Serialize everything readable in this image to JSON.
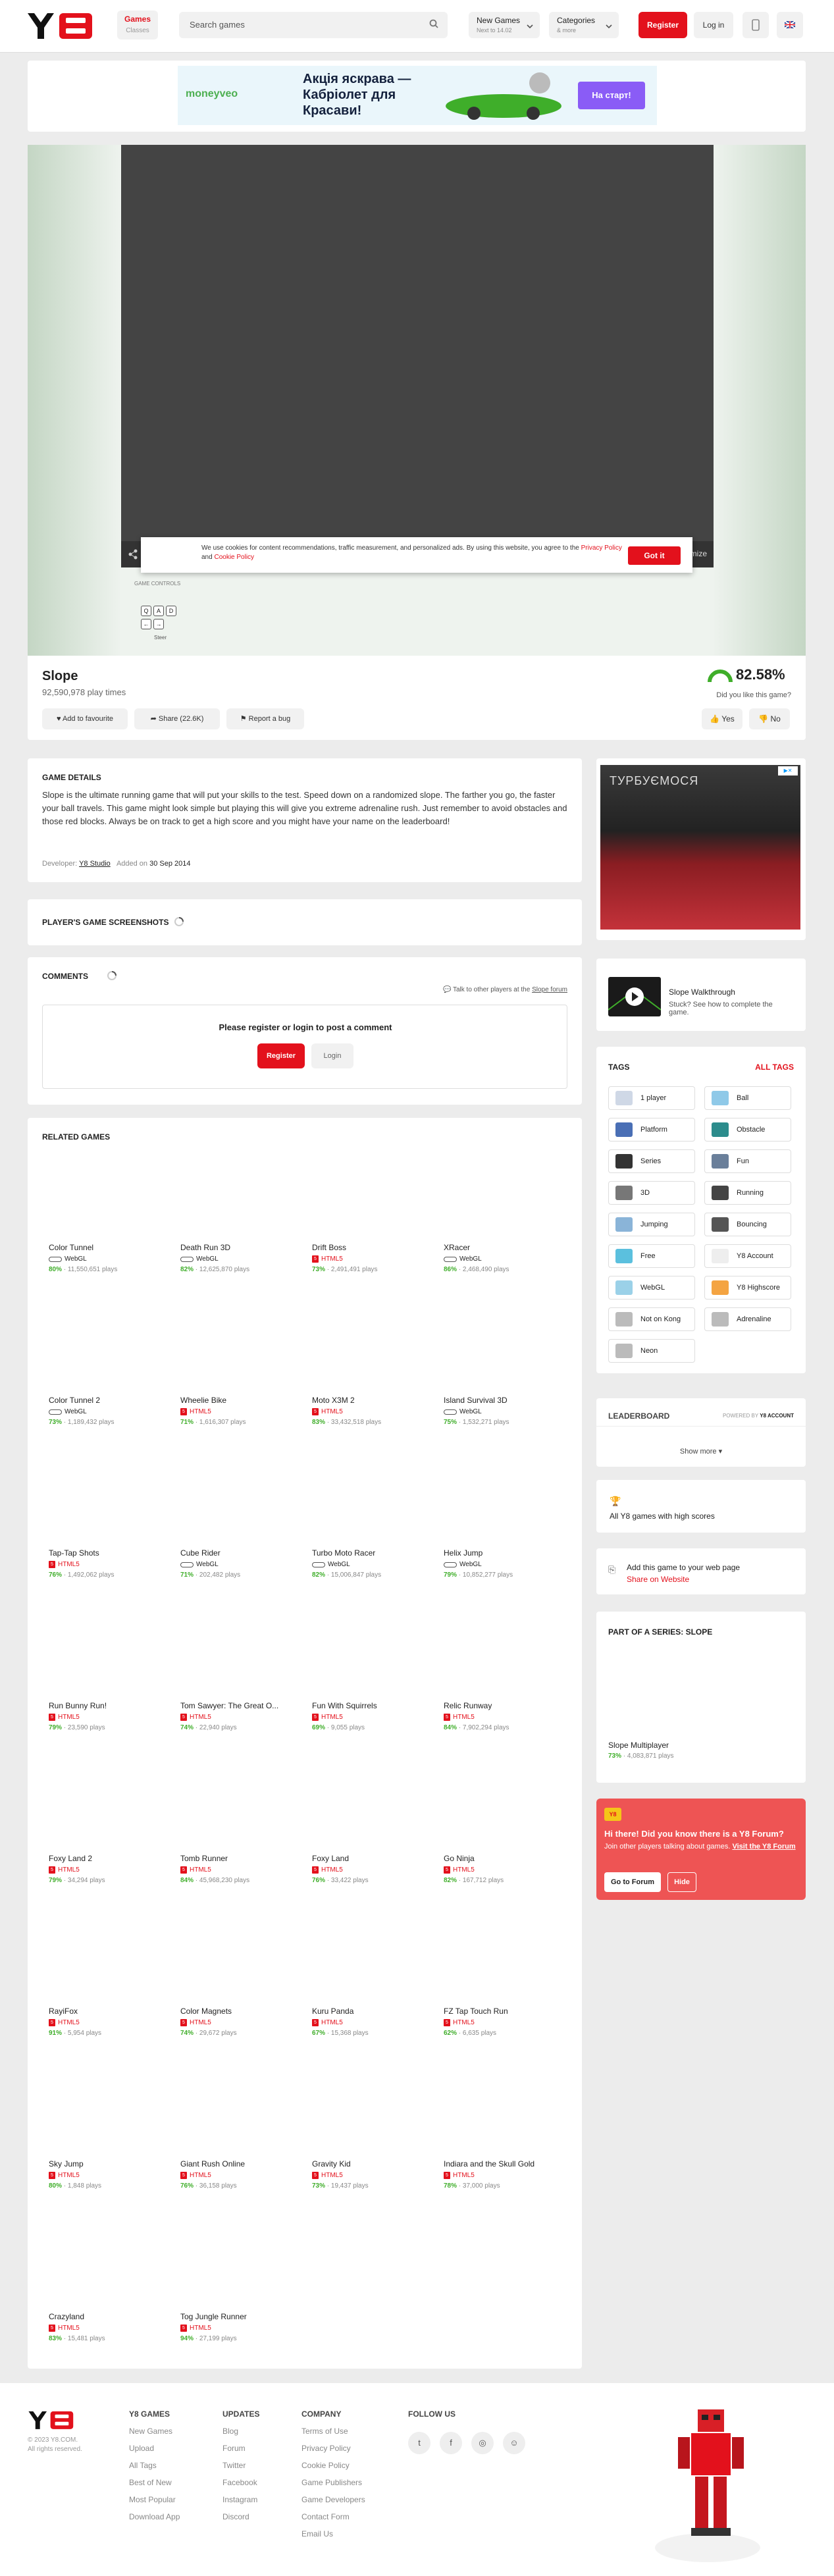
{
  "header": {
    "games_label": "Games",
    "games_sub": "Classes",
    "search_placeholder": "Search games",
    "new_games": "New Games",
    "new_games_sub": "Next to 14.02",
    "categories": "Categories",
    "categories_sub": "& more",
    "register": "Register",
    "login": "Log in"
  },
  "ad": {
    "brand": "moneyveo",
    "headline": "Акція яскрава — Кабріолет для Красави!",
    "cta": "На старт!"
  },
  "player": {
    "cookie_text": "We use cookies for content recommendations, traffic measurement, and personalized ads. By using this website, you agree to the",
    "privacy": "Privacy Policy",
    "and": "and",
    "cookie_policy": "Cookie Policy",
    "got_it": "Got it",
    "controls_label": "GAME CONTROLS",
    "keys": [
      "Q",
      "A",
      "D"
    ],
    "steer": "Steer",
    "fullscreen": "mize"
  },
  "game": {
    "title": "Slope",
    "plays": "92,590,978 play times",
    "add_fav": "Add to favourite",
    "share": "Share (22.6K)",
    "report": "Report a bug",
    "rating": "82.58%",
    "like_q": "Did you like this game?",
    "yes": "Yes",
    "no": "No"
  },
  "details": {
    "heading": "GAME DETAILS",
    "description": "Slope is the ultimate running game that will put your skills to the test. Speed down on a randomized slope. The farther you go, the faster your ball travels. This game might look simple but playing this will give you extreme adrenaline rush. Just remember to avoid obstacles and those red blocks. Always be on track to get a high score and you might have your name on the leaderboard!",
    "developer_label": "Developer:",
    "developer": "Y8 Studio",
    "added_label": "Added on",
    "added": "30 Sep 2014"
  },
  "screenshots": {
    "heading": "PLAYER'S GAME SCREENSHOTS"
  },
  "comments": {
    "heading": "COMMENTS",
    "forum_text": "Talk to other players at the",
    "forum_link": "Slope forum",
    "prompt": "Please register or login to post a comment",
    "register": "Register",
    "login": "Login"
  },
  "related": {
    "heading": "RELATED GAMES",
    "games": [
      {
        "title": "Color Tunnel",
        "tech": "WebGL",
        "rating": "80%",
        "plays": "11,550,651 plays"
      },
      {
        "title": "Death Run 3D",
        "tech": "WebGL",
        "rating": "82%",
        "plays": "12,625,870 plays"
      },
      {
        "title": "Drift Boss",
        "tech": "HTML5",
        "rating": "73%",
        "plays": "2,491,491 plays"
      },
      {
        "title": "XRacer",
        "tech": "WebGL",
        "rating": "86%",
        "plays": "2,468,490 plays"
      },
      {
        "title": "Color Tunnel 2",
        "tech": "WebGL",
        "rating": "73%",
        "plays": "1,189,432 plays"
      },
      {
        "title": "Wheelie Bike",
        "tech": "HTML5",
        "rating": "71%",
        "plays": "1,616,307 plays"
      },
      {
        "title": "Moto X3M 2",
        "tech": "HTML5",
        "rating": "83%",
        "plays": "33,432,518 plays"
      },
      {
        "title": "Island Survival 3D",
        "tech": "WebGL",
        "rating": "75%",
        "plays": "1,532,271 plays"
      },
      {
        "title": "Tap-Tap Shots",
        "tech": "HTML5",
        "rating": "76%",
        "plays": "1,492,062 plays"
      },
      {
        "title": "Cube Rider",
        "tech": "WebGL",
        "rating": "71%",
        "plays": "202,482 plays"
      },
      {
        "title": "Turbo Moto Racer",
        "tech": "WebGL",
        "rating": "82%",
        "plays": "15,006,847 plays"
      },
      {
        "title": "Helix Jump",
        "tech": "WebGL",
        "rating": "79%",
        "plays": "10,852,277 plays"
      },
      {
        "title": "Run Bunny Run!",
        "tech": "HTML5",
        "rating": "79%",
        "plays": "23,590 plays"
      },
      {
        "title": "Tom Sawyer: The Great O...",
        "tech": "HTML5",
        "rating": "74%",
        "plays": "22,940 plays"
      },
      {
        "title": "Fun With Squirrels",
        "tech": "HTML5",
        "rating": "69%",
        "plays": "9,055 plays"
      },
      {
        "title": "Relic Runway",
        "tech": "HTML5",
        "rating": "84%",
        "plays": "7,902,294 plays"
      },
      {
        "title": "Foxy Land 2",
        "tech": "HTML5",
        "rating": "79%",
        "plays": "34,294 plays"
      },
      {
        "title": "Tomb Runner",
        "tech": "HTML5",
        "rating": "84%",
        "plays": "45,968,230 plays"
      },
      {
        "title": "Foxy Land",
        "tech": "HTML5",
        "rating": "76%",
        "plays": "33,422 plays"
      },
      {
        "title": "Go Ninja",
        "tech": "HTML5",
        "rating": "82%",
        "plays": "167,712 plays"
      },
      {
        "title": "RayiFox",
        "tech": "HTML5",
        "rating": "91%",
        "plays": "5,954 plays"
      },
      {
        "title": "Color Magnets",
        "tech": "HTML5",
        "rating": "74%",
        "plays": "29,672 plays"
      },
      {
        "title": "Kuru Panda",
        "tech": "HTML5",
        "rating": "67%",
        "plays": "15,368 plays"
      },
      {
        "title": "FZ Tap Touch Run",
        "tech": "HTML5",
        "rating": "62%",
        "plays": "6,635 plays"
      },
      {
        "title": "Sky Jump",
        "tech": "HTML5",
        "rating": "80%",
        "plays": "1,848 plays"
      },
      {
        "title": "Giant Rush Online",
        "tech": "HTML5",
        "rating": "76%",
        "plays": "36,158 plays"
      },
      {
        "title": "Gravity Kid",
        "tech": "HTML5",
        "rating": "73%",
        "plays": "19,437 plays"
      },
      {
        "title": "Indiara and the Skull Gold",
        "tech": "HTML5",
        "rating": "78%",
        "plays": "37,000 plays"
      },
      {
        "title": "Crazyland",
        "tech": "HTML5",
        "rating": "83%",
        "plays": "15,481 plays"
      },
      {
        "title": "Tog Jungle Runner",
        "tech": "HTML5",
        "rating": "94%",
        "plays": "27,199 plays"
      }
    ]
  },
  "sidebar": {
    "ad_text": "ТУРБУЄМОСЯ",
    "walkthrough_title": "Slope Walkthrough",
    "walkthrough_sub": "Stuck? See how to complete the game.",
    "tags_heading": "TAGS",
    "all_tags": "ALL TAGS",
    "tags": [
      "1 player",
      "Ball",
      "Platform",
      "Obstacle",
      "Series",
      "Fun",
      "3D",
      "Running",
      "Jumping",
      "Bouncing",
      "Free",
      "Y8 Account",
      "WebGL",
      "Y8 Highscore",
      "Not on Kong",
      "Adrenaline",
      "Neon"
    ],
    "leaderboard": "LEADERBOARD",
    "powered_by": "POWERED BY",
    "powered_brand": "Y8 ACCOUNT",
    "show_more": "Show more",
    "highscore": "All Y8 games with high scores",
    "embed_title": "Add this game to your web page",
    "embed_link": "Share on Website",
    "series_heading": "PART OF A SERIES: SLOPE",
    "series_game": "Slope Multiplayer",
    "series_rating": "73%",
    "series_plays": "4,083,871 plays",
    "forum_badge": "Y8",
    "forum_title": "Hi there! Did you know there is a Y8 Forum?",
    "forum_text": "Join other players talking about games.",
    "forum_link": "Visit the Y8 Forum",
    "forum_go": "Go to Forum",
    "forum_hide": "Hide"
  },
  "footer": {
    "copyright": "© 2023 Y8.COM.",
    "rights": "All rights reserved.",
    "col1_title": "Y8 GAMES",
    "col1": [
      "New Games",
      "Upload",
      "All Tags",
      "Best of New",
      "Most Popular",
      "Download App"
    ],
    "col2_title": "UPDATES",
    "col2": [
      "Blog",
      "Forum",
      "Twitter",
      "Facebook",
      "Instagram",
      "Discord"
    ],
    "col3_title": "COMPANY",
    "col3": [
      "Terms of Use",
      "Privacy Policy",
      "Cookie Policy",
      "Game Publishers",
      "Game Developers",
      "Contact Form",
      "Email Us"
    ],
    "follow": "FOLLOW US"
  },
  "colors": {
    "brand_red": "#e3111c",
    "rating_green": "#3fae2a"
  }
}
